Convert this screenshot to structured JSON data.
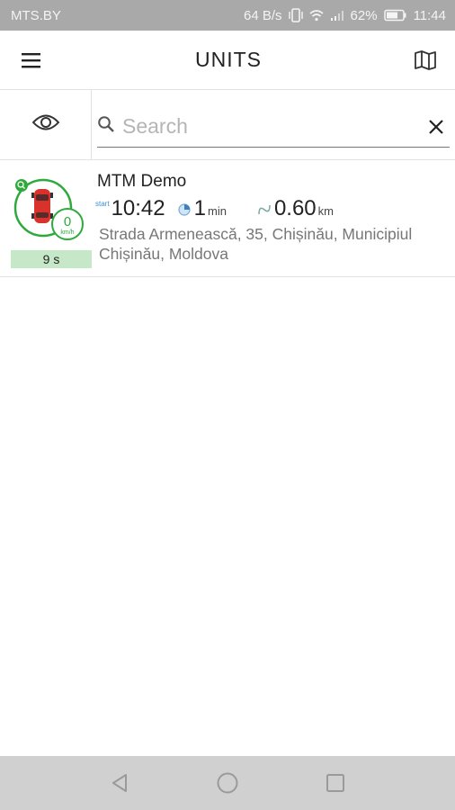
{
  "status_bar": {
    "carrier": "MTS.BY",
    "speed": "64 B/s",
    "battery": "62%",
    "time": "11:44"
  },
  "app_bar": {
    "title": "UNITS",
    "menu_icon": "menu-icon",
    "map_icon": "map-icon"
  },
  "search": {
    "placeholder": "Search",
    "value": "",
    "eye_icon": "eye-icon",
    "clear_icon": "close-icon"
  },
  "units": [
    {
      "name": "MTM Demo",
      "speed": "0",
      "speed_unit": "km/h",
      "idle": "9 s",
      "start_label": "start",
      "start_time": "10:42",
      "duration": "1",
      "duration_unit": "min",
      "distance": "0.60",
      "distance_unit": "km",
      "address": "Strada Armenească, 35, Chișinău, Municipiul Chișinău, Moldova",
      "status_color": "#2eaa3c",
      "car_color": "#d9312b"
    }
  ],
  "nav": {
    "back_icon": "back-triangle-icon",
    "home_icon": "home-circle-icon",
    "recents_icon": "recents-square-icon"
  }
}
